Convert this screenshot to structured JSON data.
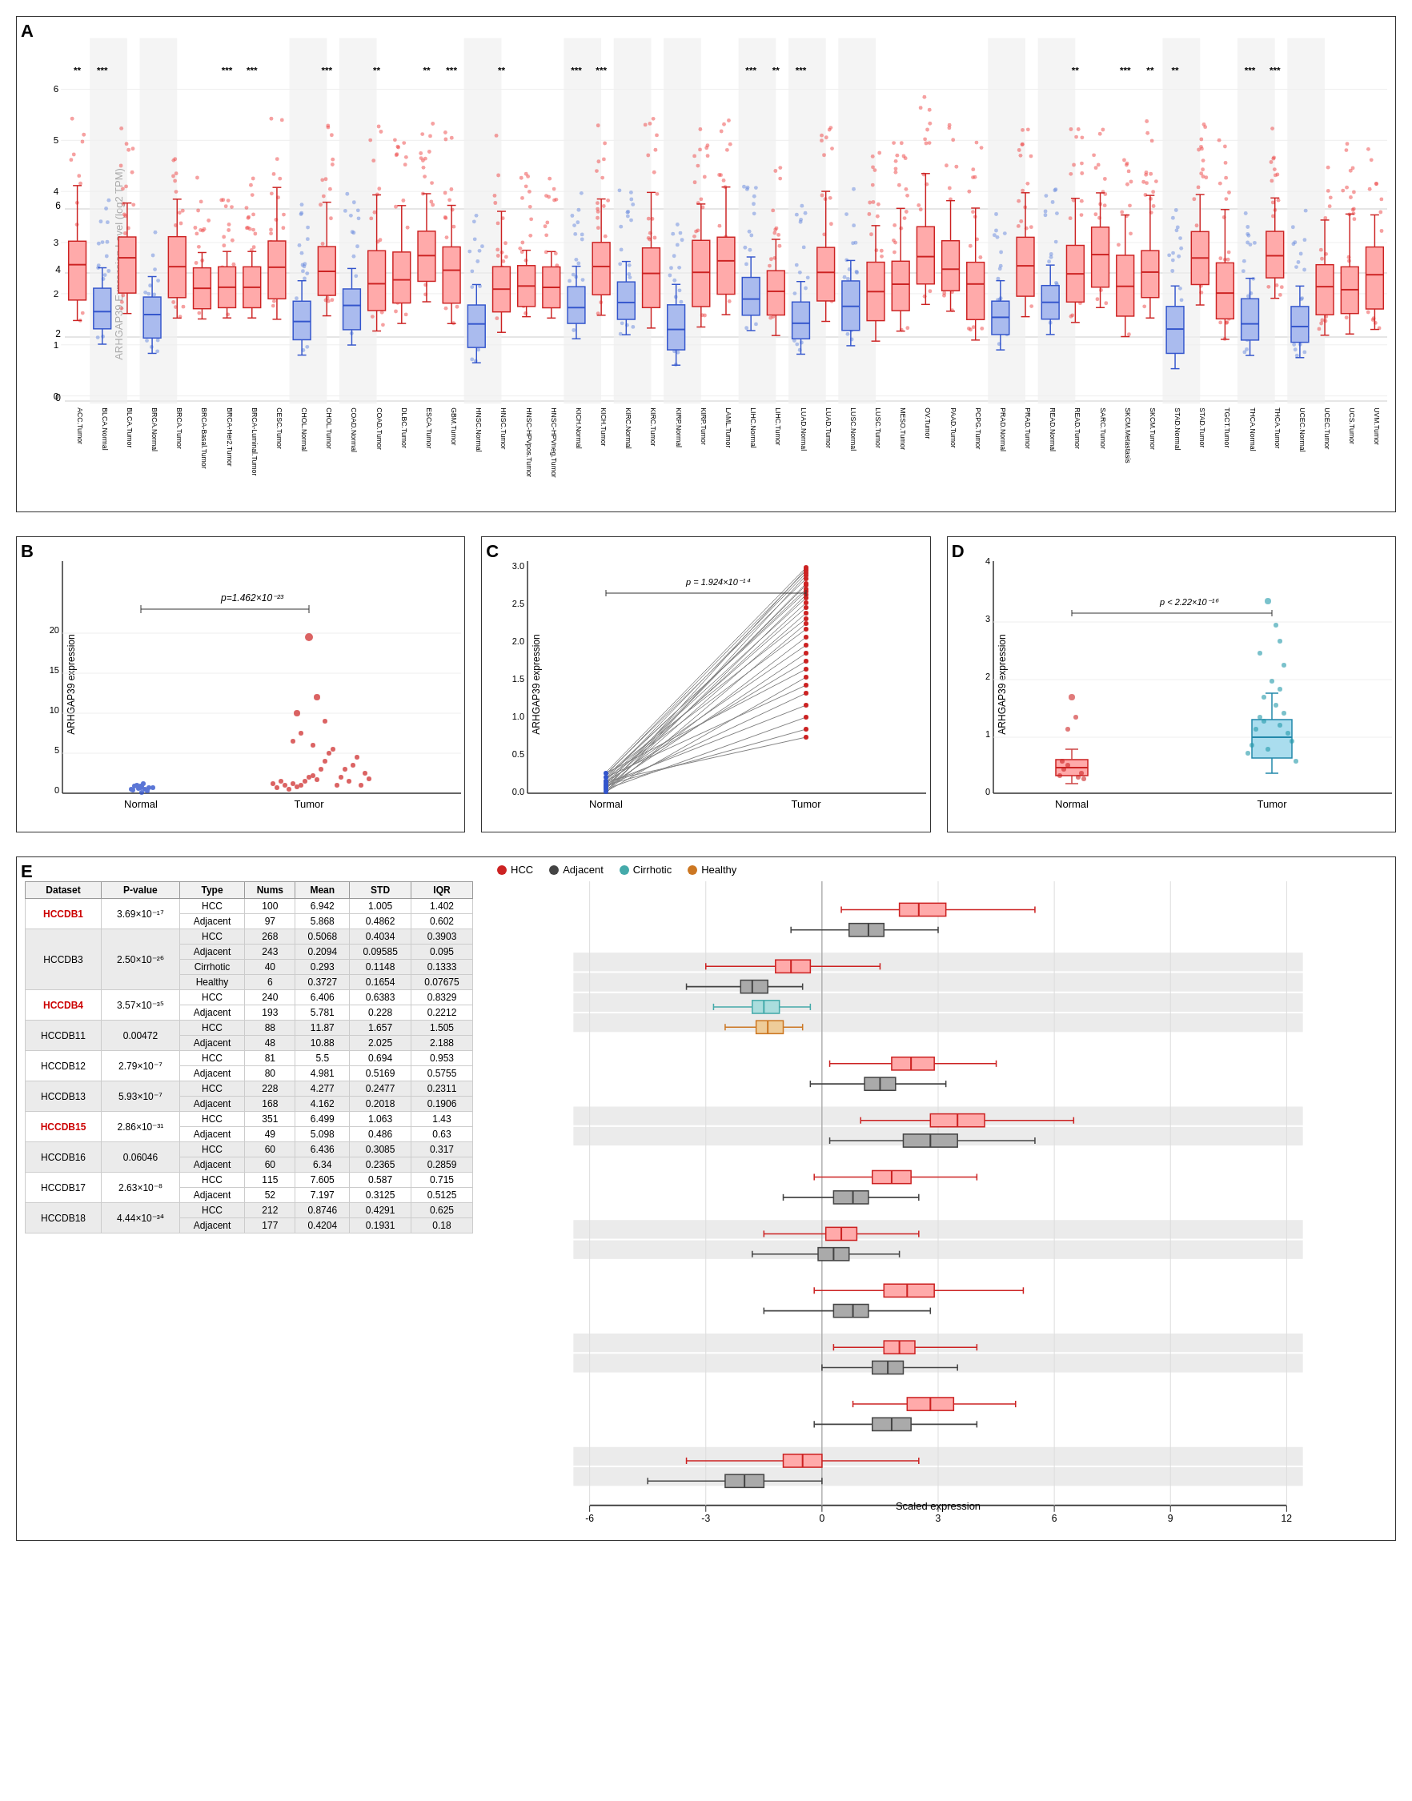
{
  "panels": {
    "a": {
      "label": "A",
      "y_axis": "ARHGAP39 Expression Level (log2 TPM)",
      "x_labels": [
        "ACC.Tumor",
        "BLCA.Normal",
        "BLCA.Tumor",
        "BRCA.Normal",
        "BRCA.Tumor",
        "BRCA-Basal.Tumor",
        "BRCA-Her2.Tumor",
        "BRCA-Luminal.Tumor",
        "CESC.Tumor",
        "CHOL.Normal",
        "CHOL.Tumor",
        "COAD.Normal",
        "COAD.Tumor",
        "DLBC.Tumor",
        "ESCA.Tumor",
        "GBM.Tumor",
        "HNSC.Normal",
        "HNSC.Tumor",
        "HNSC-HPVpos.Tumor",
        "HNSC-HPVneg.Tumor",
        "KICH.Normal",
        "KICH.Tumor",
        "KIRC.Normal",
        "KIRC.Tumor",
        "KIRP.Normal",
        "KIRP.Tumor",
        "LAML.Tumor",
        "LIHC.Normal",
        "LIHC.Tumor",
        "LUAD.Normal",
        "LUAD.Tumor",
        "LUSC.Normal",
        "LUSC.Tumor",
        "MESO.Tumor",
        "OV.Tumor",
        "PAAD.Tumor",
        "PCPG.Tumor",
        "PRAD.Normal",
        "PRAD.Tumor",
        "READ.Normal",
        "READ.Tumor",
        "SARC.Tumor",
        "SKCM.Metastasis",
        "SKCM.Tumor",
        "STAD.Normal",
        "STAD.Tumor",
        "TGCT.Tumor",
        "THCA.Normal",
        "THCA.Tumor",
        "UCEC.Normal",
        "UCEC.Tumor",
        "UCS.Tumor",
        "UVM.Tumor"
      ],
      "sig_positions": [
        0,
        1,
        6,
        7,
        10,
        12,
        16,
        18,
        20,
        21,
        27,
        28,
        29,
        34,
        40,
        42,
        44,
        47,
        48
      ]
    },
    "b": {
      "label": "B",
      "y_axis": "ARHGAP39 expression",
      "p_value": "p=1.462×10⁻²³",
      "x_labels": [
        "Normal",
        "Tumor"
      ]
    },
    "c": {
      "label": "C",
      "y_axis": "ARHGAP39 expression",
      "p_value": "p = 1.924×10⁻¹⁴",
      "x_labels": [
        "Normal",
        "Tumor"
      ],
      "y_ticks": [
        "0.0",
        "0.5",
        "1.0",
        "1.5",
        "2.0",
        "2.5",
        "3.0"
      ]
    },
    "d": {
      "label": "D",
      "y_axis": "ARHGAP39 expression",
      "p_value": "p < 2.22×10⁻¹⁶",
      "x_labels": [
        "Normal",
        "Tumor"
      ],
      "y_ticks": [
        "0",
        "1",
        "2",
        "3",
        "4"
      ]
    }
  },
  "panel_e": {
    "label": "E",
    "legend": [
      {
        "label": "HCC",
        "color": "#cc2222"
      },
      {
        "label": "Adjacent",
        "color": "#444444"
      },
      {
        "label": "Cirrhotic",
        "color": "#44aaaa"
      },
      {
        "label": "Healthy",
        "color": "#cc7722"
      }
    ],
    "table_headers": [
      "Dataset",
      "P-value",
      "Type",
      "Nums",
      "Mean",
      "STD",
      "IQR"
    ],
    "rows": [
      {
        "dataset": "HCCDB1",
        "dataset_red": true,
        "pvalue": "3.69×10⁻¹⁷",
        "rowspan": 2,
        "entries": [
          {
            "type": "HCC",
            "nums": "100",
            "mean": "6.942",
            "std": "1.005",
            "iqr": "1.402"
          },
          {
            "type": "Adjacent",
            "nums": "97",
            "mean": "5.868",
            "std": "0.4862",
            "iqr": "0.602"
          }
        ]
      },
      {
        "dataset": "HCCDB3",
        "dataset_red": false,
        "pvalue": "2.50×10⁻²⁶",
        "rowspan": 4,
        "entries": [
          {
            "type": "HCC",
            "nums": "268",
            "mean": "0.5068",
            "std": "0.4034",
            "iqr": "0.3903"
          },
          {
            "type": "Adjacent",
            "nums": "243",
            "mean": "0.2094",
            "std": "0.09585",
            "iqr": "0.095"
          },
          {
            "type": "Cirrhotic",
            "nums": "40",
            "mean": "0.293",
            "std": "0.1148",
            "iqr": "0.1333"
          },
          {
            "type": "Healthy",
            "nums": "6",
            "mean": "0.3727",
            "std": "0.1654",
            "iqr": "0.07675"
          }
        ]
      },
      {
        "dataset": "HCCDB4",
        "dataset_red": true,
        "pvalue": "3.57×10⁻³⁵",
        "rowspan": 2,
        "entries": [
          {
            "type": "HCC",
            "nums": "240",
            "mean": "6.406",
            "std": "0.6383",
            "iqr": "0.8329"
          },
          {
            "type": "Adjacent",
            "nums": "193",
            "mean": "5.781",
            "std": "0.228",
            "iqr": "0.2212"
          }
        ]
      },
      {
        "dataset": "HCCDB11",
        "dataset_red": false,
        "pvalue": "0.00472",
        "rowspan": 2,
        "entries": [
          {
            "type": "HCC",
            "nums": "88",
            "mean": "11.87",
            "std": "1.657",
            "iqr": "1.505"
          },
          {
            "type": "Adjacent",
            "nums": "48",
            "mean": "10.88",
            "std": "2.025",
            "iqr": "2.188"
          }
        ]
      },
      {
        "dataset": "HCCDB12",
        "dataset_red": false,
        "pvalue": "2.79×10⁻⁷",
        "rowspan": 2,
        "entries": [
          {
            "type": "HCC",
            "nums": "81",
            "mean": "5.5",
            "std": "0.694",
            "iqr": "0.953"
          },
          {
            "type": "Adjacent",
            "nums": "80",
            "mean": "4.981",
            "std": "0.5169",
            "iqr": "0.5755"
          }
        ]
      },
      {
        "dataset": "HCCDB13",
        "dataset_red": false,
        "pvalue": "5.93×10⁻⁷",
        "rowspan": 2,
        "entries": [
          {
            "type": "HCC",
            "nums": "228",
            "mean": "4.277",
            "std": "0.2477",
            "iqr": "0.2311"
          },
          {
            "type": "Adjacent",
            "nums": "168",
            "mean": "4.162",
            "std": "0.2018",
            "iqr": "0.1906"
          }
        ]
      },
      {
        "dataset": "HCCDB15",
        "dataset_red": true,
        "pvalue": "2.86×10⁻³¹",
        "rowspan": 2,
        "entries": [
          {
            "type": "HCC",
            "nums": "351",
            "mean": "6.499",
            "std": "1.063",
            "iqr": "1.43"
          },
          {
            "type": "Adjacent",
            "nums": "49",
            "mean": "5.098",
            "std": "0.486",
            "iqr": "0.63"
          }
        ]
      },
      {
        "dataset": "HCCDB16",
        "dataset_red": false,
        "pvalue": "0.06046",
        "rowspan": 2,
        "entries": [
          {
            "type": "HCC",
            "nums": "60",
            "mean": "6.436",
            "std": "0.3085",
            "iqr": "0.317"
          },
          {
            "type": "Adjacent",
            "nums": "60",
            "mean": "6.34",
            "std": "0.2365",
            "iqr": "0.2859"
          }
        ]
      },
      {
        "dataset": "HCCDB17",
        "dataset_red": false,
        "pvalue": "2.63×10⁻⁸",
        "rowspan": 2,
        "entries": [
          {
            "type": "HCC",
            "nums": "115",
            "mean": "7.605",
            "std": "0.587",
            "iqr": "0.715"
          },
          {
            "type": "Adjacent",
            "nums": "52",
            "mean": "7.197",
            "std": "0.3125",
            "iqr": "0.5125"
          }
        ]
      },
      {
        "dataset": "HCCDB18",
        "dataset_red": false,
        "pvalue": "4.44×10⁻³⁴",
        "rowspan": 2,
        "entries": [
          {
            "type": "HCC",
            "nums": "212",
            "mean": "0.8746",
            "std": "0.4291",
            "iqr": "0.625"
          },
          {
            "type": "Adjacent",
            "nums": "177",
            "mean": "0.4204",
            "std": "0.1931",
            "iqr": "0.18"
          }
        ]
      }
    ],
    "x_axis_label": "Scaled expression",
    "x_ticks": [
      "-6",
      "-3",
      "0",
      "3",
      "6",
      "9",
      "12"
    ]
  },
  "colors": {
    "tumor_red": "#cc2222",
    "normal_blue": "#2244cc",
    "hcc_red": "#cc2222",
    "adjacent_dark": "#444444",
    "cirrhotic_teal": "#44aaaa",
    "healthy_orange": "#cc7722",
    "box_red": "#dd3333",
    "box_blue": "#3355cc"
  }
}
